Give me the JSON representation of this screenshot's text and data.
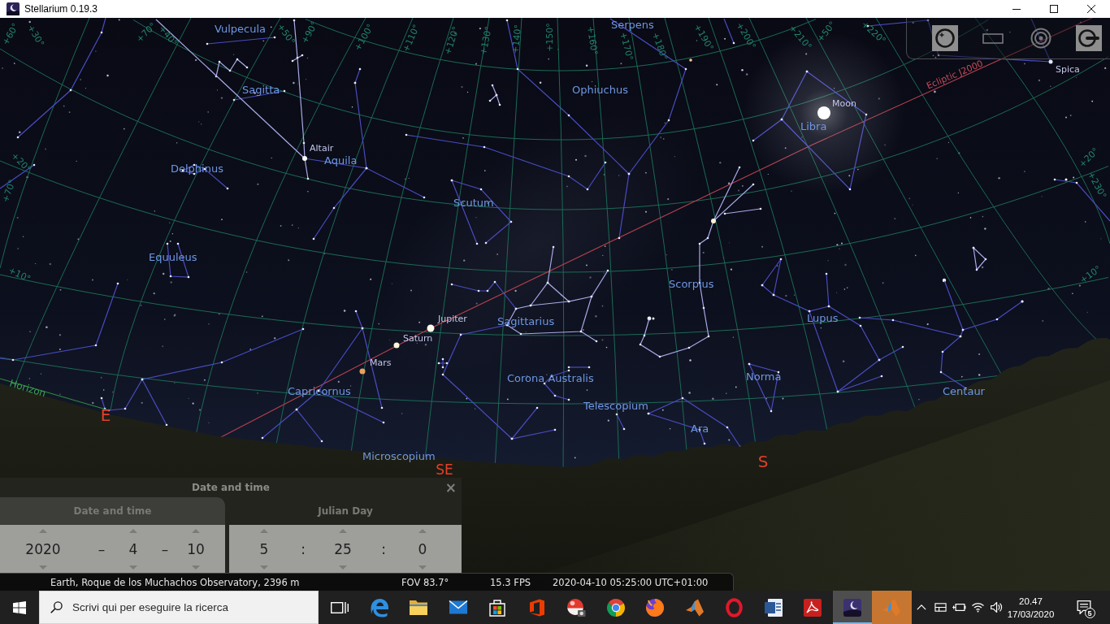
{
  "window": {
    "title": "Stellarium 0.19.3"
  },
  "sky": {
    "constellations": [
      "Vulpecula",
      "Serpens",
      "Ophiuchus",
      "Sagitta",
      "Libra",
      "Aquila",
      "Delphinus",
      "Scutum",
      "Equuleus",
      "Scorpius",
      "Lupus",
      "Sagittarius",
      "Norma",
      "Corona Australis",
      "Capricornus",
      "Centaur",
      "Telescopium",
      "Ara",
      "Microscopium"
    ],
    "objects": [
      {
        "name": "Spica",
        "kind": "star",
        "color": "#dfe6ff"
      },
      {
        "name": "Moon",
        "kind": "moon",
        "color": "#ffffff"
      },
      {
        "name": "Altair",
        "kind": "star",
        "color": "#ffffff"
      },
      {
        "name": "Jupiter",
        "kind": "planet",
        "color": "#fffbea"
      },
      {
        "name": "Saturn",
        "kind": "planet",
        "color": "#fff3d6"
      },
      {
        "name": "Mars",
        "kind": "planet",
        "color": "#e8a060"
      }
    ],
    "cardinal_points": [
      "E",
      "SE",
      "S"
    ],
    "horizon_label": "Horizon",
    "ecliptic_label": "Ecliptic J2000",
    "grid_labels": [
      "+60°",
      "+30°",
      "+70°",
      "+40°",
      "+50°",
      "+90°",
      "+100°",
      "+110°",
      "+120°",
      "+130°",
      "+140°",
      "+150°",
      "+160°",
      "+170°",
      "+180°",
      "+190°",
      "+200°",
      "+210°",
      "+50°",
      "+220°",
      "+20°",
      "+70°",
      "+10°",
      "+20°",
      "+230°",
      "+10°"
    ]
  },
  "toolbar": {
    "buttons": [
      {
        "kind": "mount",
        "on": true
      },
      {
        "kind": "frame",
        "on": false
      },
      {
        "kind": "target",
        "on": false
      },
      {
        "kind": "tools",
        "on": true
      }
    ]
  },
  "date_time_dialog": {
    "title": "Date and time",
    "close": "×",
    "tabs": [
      {
        "label": "Date and time",
        "selected": true
      },
      {
        "label": "Julian Day",
        "selected": false
      }
    ],
    "date": {
      "fields": [
        "2020",
        "4",
        "10"
      ],
      "separators": [
        "–",
        "–"
      ]
    },
    "time": {
      "fields": [
        "5",
        "25",
        "0"
      ],
      "separators": [
        ":",
        ":"
      ]
    }
  },
  "status_bar": {
    "location": "Earth, Roque de los Muchachos Observatory, 2396 m",
    "fov": "FOV 83.7°",
    "fps": "15.3 FPS",
    "datetime": "2020-04-10 05:25:00 UTC+01:00"
  },
  "taskbar": {
    "search": {
      "placeholder": "Scrivi qui per eseguire la ricerca"
    },
    "apps": [
      {
        "kind": "taskview",
        "selected": false,
        "flashing": false
      },
      {
        "kind": "swirl",
        "selected": false,
        "flashing": false
      },
      {
        "kind": "folder",
        "selected": false,
        "flashing": false
      },
      {
        "kind": "envelope",
        "selected": false,
        "flashing": false
      },
      {
        "kind": "bag",
        "selected": false,
        "flashing": false
      },
      {
        "kind": "tile",
        "selected": false,
        "flashing": false
      },
      {
        "kind": "ball",
        "selected": false,
        "flashing": false
      },
      {
        "kind": "wheel",
        "selected": false,
        "flashing": false
      },
      {
        "kind": "flame",
        "selected": false,
        "flashing": false
      },
      {
        "kind": "peak",
        "selected": false,
        "flashing": false
      },
      {
        "kind": "ring",
        "selected": false,
        "flashing": false
      },
      {
        "kind": "document",
        "selected": false,
        "flashing": false
      },
      {
        "kind": "curl",
        "selected": false,
        "flashing": false
      },
      {
        "kind": "sky",
        "selected": true,
        "flashing": false
      },
      {
        "kind": "peak",
        "selected": false,
        "flashing": true
      }
    ],
    "clock": {
      "time": "20.47",
      "date": "17/03/2020"
    },
    "notifications": "5"
  }
}
